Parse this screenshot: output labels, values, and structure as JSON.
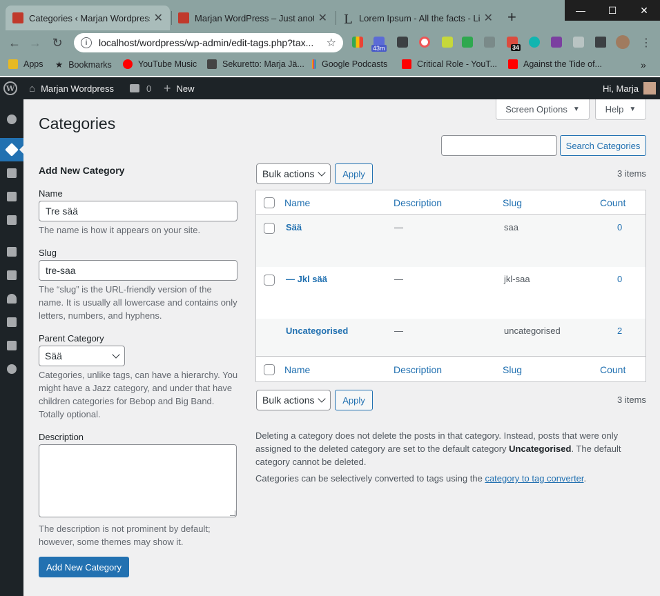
{
  "browser": {
    "tabs": [
      {
        "title": "Categories ‹ Marjan Wordpress —",
        "fav_color": "#c0392b"
      },
      {
        "title": "Marjan WordPress – Just another",
        "fav_color": "#c0392b"
      },
      {
        "title": "Lorem Ipsum - All the facts - Lips",
        "fav_letter": "L"
      }
    ],
    "newtab_label": "+",
    "url": "localhost/wordpress/wp-admin/edit-tags.php?tax...",
    "ext_badges": {
      "timer": "43m",
      "todoist": "34"
    },
    "bookmarks": [
      {
        "label": "Apps",
        "color": "#e8b923"
      },
      {
        "label": "Bookmarks",
        "icon": "★"
      },
      {
        "label": "YouTube Music",
        "color": "#ff0000"
      },
      {
        "label": "Sekuretto: Marja Jä...",
        "color": "#444"
      },
      {
        "label": "Google Podcasts",
        "color": "#4285f4"
      },
      {
        "label": "Critical Role - YouT...",
        "color": "#ff0000"
      },
      {
        "label": "Against the Tide of...",
        "color": "#ff0000"
      }
    ],
    "bookmarks_more": "»"
  },
  "adminbar": {
    "site_name": "Marjan Wordpress",
    "comments_count": "0",
    "new_label": "New",
    "greeting": "Hi, Marja"
  },
  "page": {
    "title": "Categories",
    "screen_options": "Screen Options",
    "help": "Help",
    "search_button": "Search Categories",
    "search_placeholder": ""
  },
  "form": {
    "heading": "Add New Category",
    "name_label": "Name",
    "name_value": "Tre sää",
    "name_desc": "The name is how it appears on your site.",
    "slug_label": "Slug",
    "slug_value": "tre-saa",
    "slug_desc_1": "The “slug” is the URL-friendly version of the",
    "slug_desc_2": "name. It is usually all lowercase and contains only",
    "slug_desc_3": "letters, numbers, and hyphens.",
    "parent_label": "Parent Category",
    "parent_value": "Sää",
    "parent_desc_1": "Categories, unlike tags, can have a hierarchy. You",
    "parent_desc_2": "might have a Jazz category, and under that have",
    "parent_desc_3": "children categories for Bebop and Big Band.",
    "parent_desc_4": "Totally optional.",
    "description_label": "Description",
    "description_value": "",
    "description_desc_1": "The description is not prominent by default;",
    "description_desc_2": "however, some themes may show it.",
    "submit": "Add New Category"
  },
  "list": {
    "bulk_actions": "Bulk actions",
    "apply": "Apply",
    "count_text": "3 items",
    "columns": {
      "name": "Name",
      "description": "Description",
      "slug": "Slug",
      "count": "Count"
    },
    "rows": [
      {
        "name": "Sää",
        "description": "—",
        "slug": "saa",
        "count": "0"
      },
      {
        "name": "— Jkl sää",
        "description": "—",
        "slug": "jkl-saa",
        "count": "0"
      },
      {
        "name": "Uncategorised",
        "description": "—",
        "slug": "uncategorised",
        "count": "2"
      }
    ],
    "note_1a": "Deleting a category does not delete the posts in that category. Instead, posts that were only",
    "note_1b": "assigned to the deleted category are set to the default category",
    "note_1_strong": "Uncategorised",
    "note_1c": ". The default",
    "note_1d": "category cannot be deleted.",
    "note_2a": "Categories can be selectively converted to tags using the",
    "note_2_link": "category to tag converter",
    "note_2b": "."
  }
}
